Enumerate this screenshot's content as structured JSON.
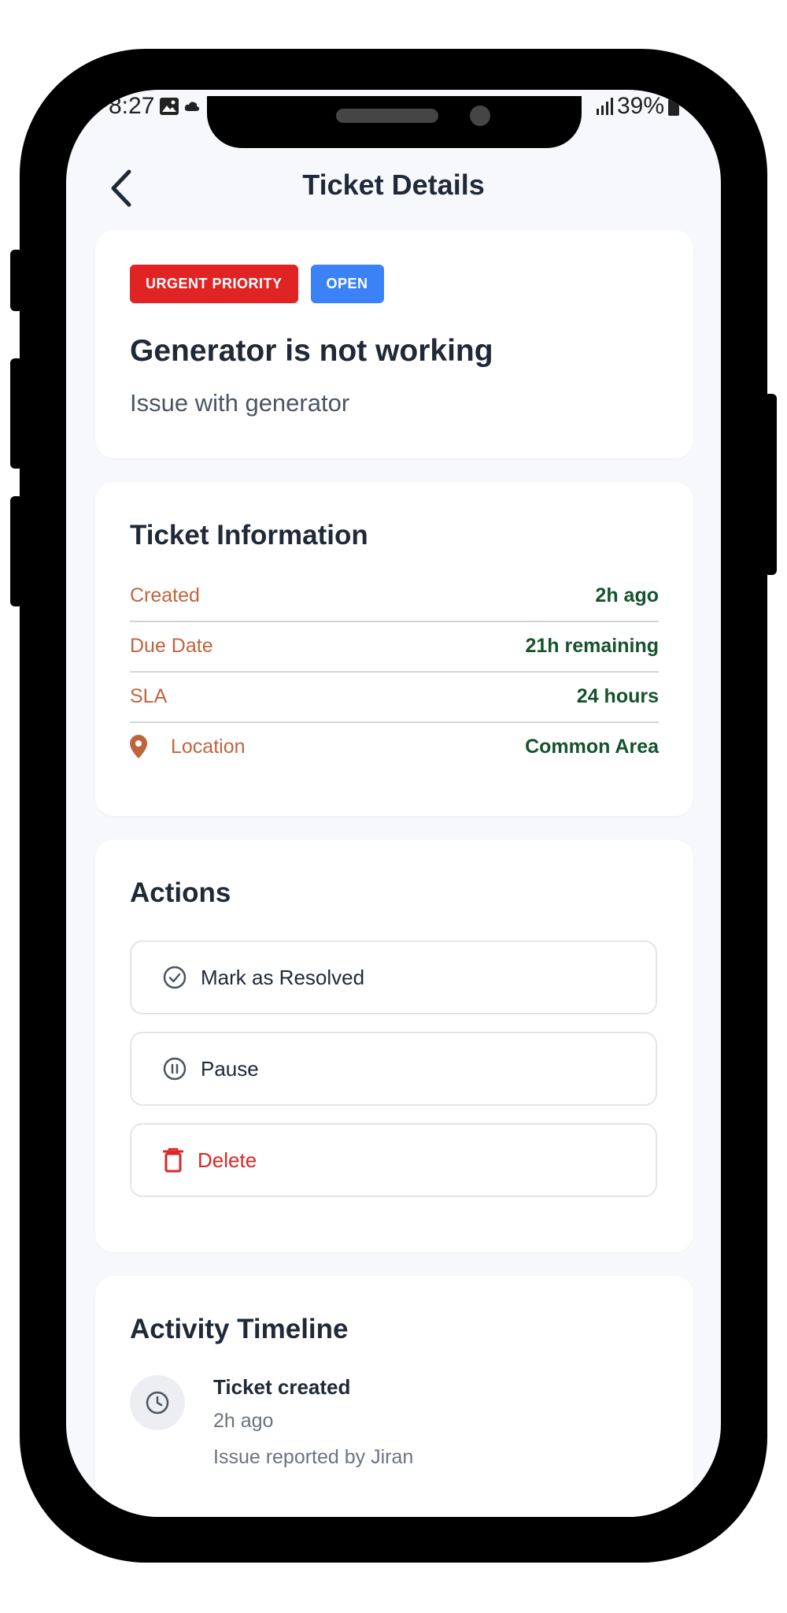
{
  "status_bar": {
    "time": "8:27",
    "battery": "39%"
  },
  "header": {
    "title": "Ticket Details"
  },
  "ticket": {
    "priority_label": "URGENT PRIORITY",
    "status_label": "OPEN",
    "title": "Generator is not working",
    "description": "Issue with generator",
    "colors": {
      "priority": "#e02424",
      "status": "#3b82f6"
    }
  },
  "info": {
    "title": "Ticket Information",
    "rows": [
      {
        "label": "Created",
        "value": "2h ago"
      },
      {
        "label": "Due Date",
        "value": "21h remaining"
      },
      {
        "label": "SLA",
        "value": "24 hours"
      },
      {
        "label": "Location",
        "value": "Common Area",
        "icon": "map-pin-icon"
      }
    ]
  },
  "actions": {
    "title": "Actions",
    "items": [
      {
        "label": "Mark as Resolved",
        "icon": "check-circle-icon"
      },
      {
        "label": "Pause",
        "icon": "pause-circle-icon"
      },
      {
        "label": "Delete",
        "icon": "trash-icon"
      }
    ]
  },
  "timeline": {
    "title": "Activity Timeline",
    "events": [
      {
        "title": "Ticket created",
        "time": "2h ago",
        "detail": "Issue reported by Jiran",
        "icon": "clock-icon"
      }
    ]
  }
}
